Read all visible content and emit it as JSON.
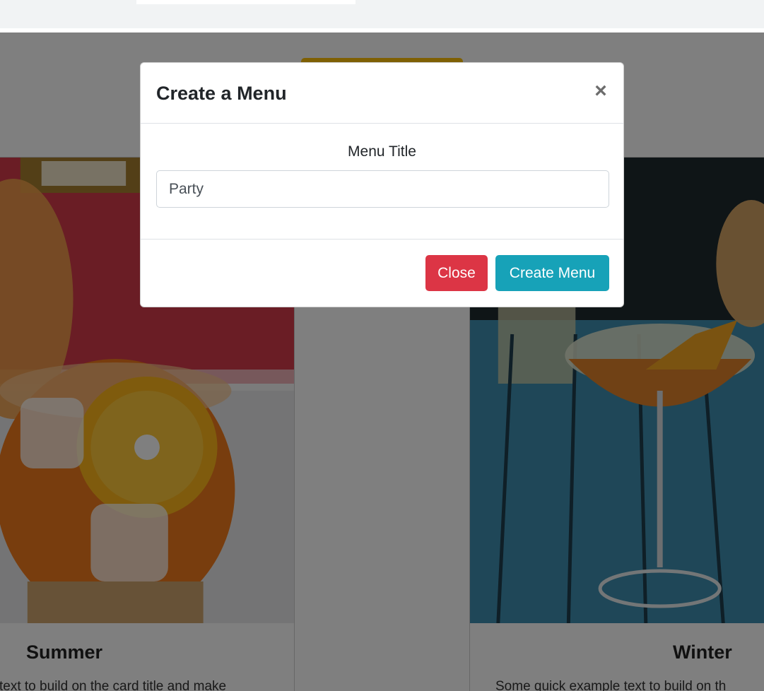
{
  "modal": {
    "title": "Create a Menu",
    "close_symbol": "×",
    "field_label": "Menu Title",
    "title_value": "Party",
    "close_button_label": "Close",
    "create_button_label": "Create Menu"
  },
  "cards": [
    {
      "title": "Summer",
      "text": "text to build on the card title and make"
    },
    {
      "title": "Winter",
      "text": "Some quick example text to build on th"
    }
  ],
  "colors": {
    "close_button": "#dc3545",
    "create_button": "#17a2b8",
    "new_menu_button": "#ffc107",
    "backdrop": "rgba(0,0,0,0.5)"
  },
  "icons": {
    "close": "close-icon"
  }
}
